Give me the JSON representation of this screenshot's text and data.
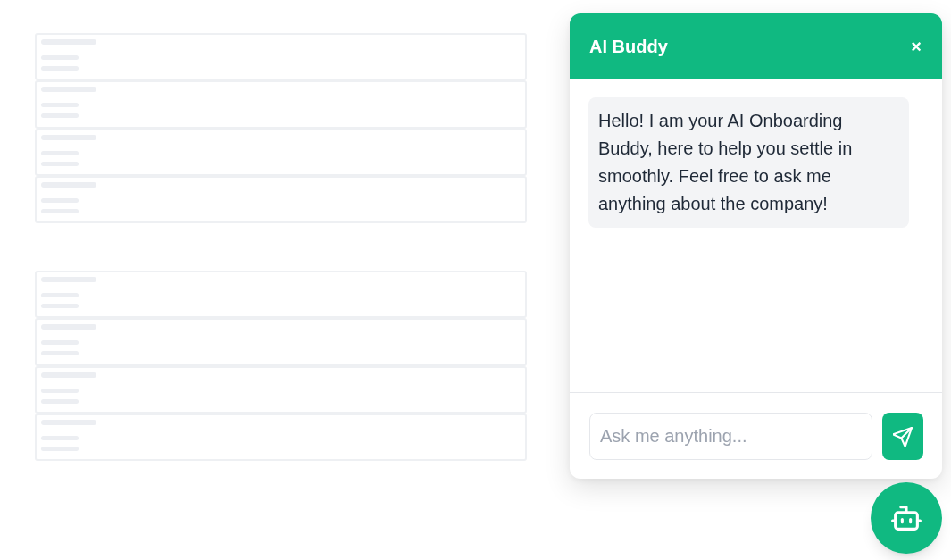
{
  "skeleton_lists": [
    {
      "rows": [
        {
          "kind": "skeleton"
        },
        {
          "kind": "skeleton"
        },
        {
          "kind": "skeleton"
        },
        {
          "kind": "skeleton"
        }
      ]
    },
    {
      "rows": [
        {
          "kind": "skeleton"
        },
        {
          "kind": "skeleton"
        },
        {
          "kind": "skeleton"
        },
        {
          "kind": "skeleton"
        }
      ]
    }
  ],
  "chat": {
    "open": true,
    "title": "AI Buddy",
    "close_glyph": "×",
    "messages": [
      {
        "kind": "bot",
        "text": "Hello! I am your AI Onboarding Buddy, here to help you settle in smoothly. Feel free to ask me anything about the company!"
      }
    ],
    "input": {
      "placeholder": "Ask me anything..."
    }
  }
}
